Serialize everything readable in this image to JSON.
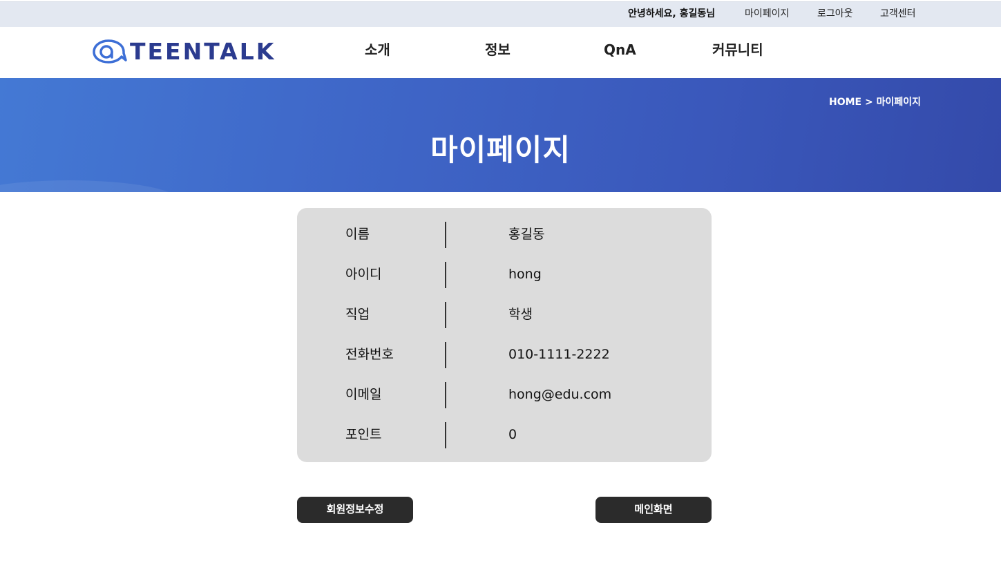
{
  "topbar": {
    "greeting": "안녕하세요, 홍길동님",
    "mypage": "마이페이지",
    "logout": "로그아웃",
    "customer_center": "고객센터"
  },
  "header": {
    "logo_text": "TEENTALK",
    "nav": [
      "소개",
      "정보",
      "QnA",
      "커뮤니티"
    ]
  },
  "banner": {
    "breadcrumb": "HOME > 마이페이지",
    "title": "마이페이지"
  },
  "profile": {
    "rows": [
      {
        "label": "이름",
        "value": "홍길동"
      },
      {
        "label": "아이디",
        "value": "hong"
      },
      {
        "label": "직업",
        "value": "학생"
      },
      {
        "label": "전화번호",
        "value": "010-1111-2222"
      },
      {
        "label": "이메일",
        "value": "hong@edu.com"
      },
      {
        "label": "포인트",
        "value": "0"
      }
    ]
  },
  "buttons": {
    "edit_info": "회원정보수정",
    "main_screen": "메인화면"
  },
  "colors": {
    "topbar_bg": "#e3e8f1",
    "banner_start": "#4479d4",
    "banner_end": "#344aaa",
    "card_bg": "#dcdcdc",
    "button_bg": "#2b2b2b",
    "logo": "#2b3b8f"
  }
}
